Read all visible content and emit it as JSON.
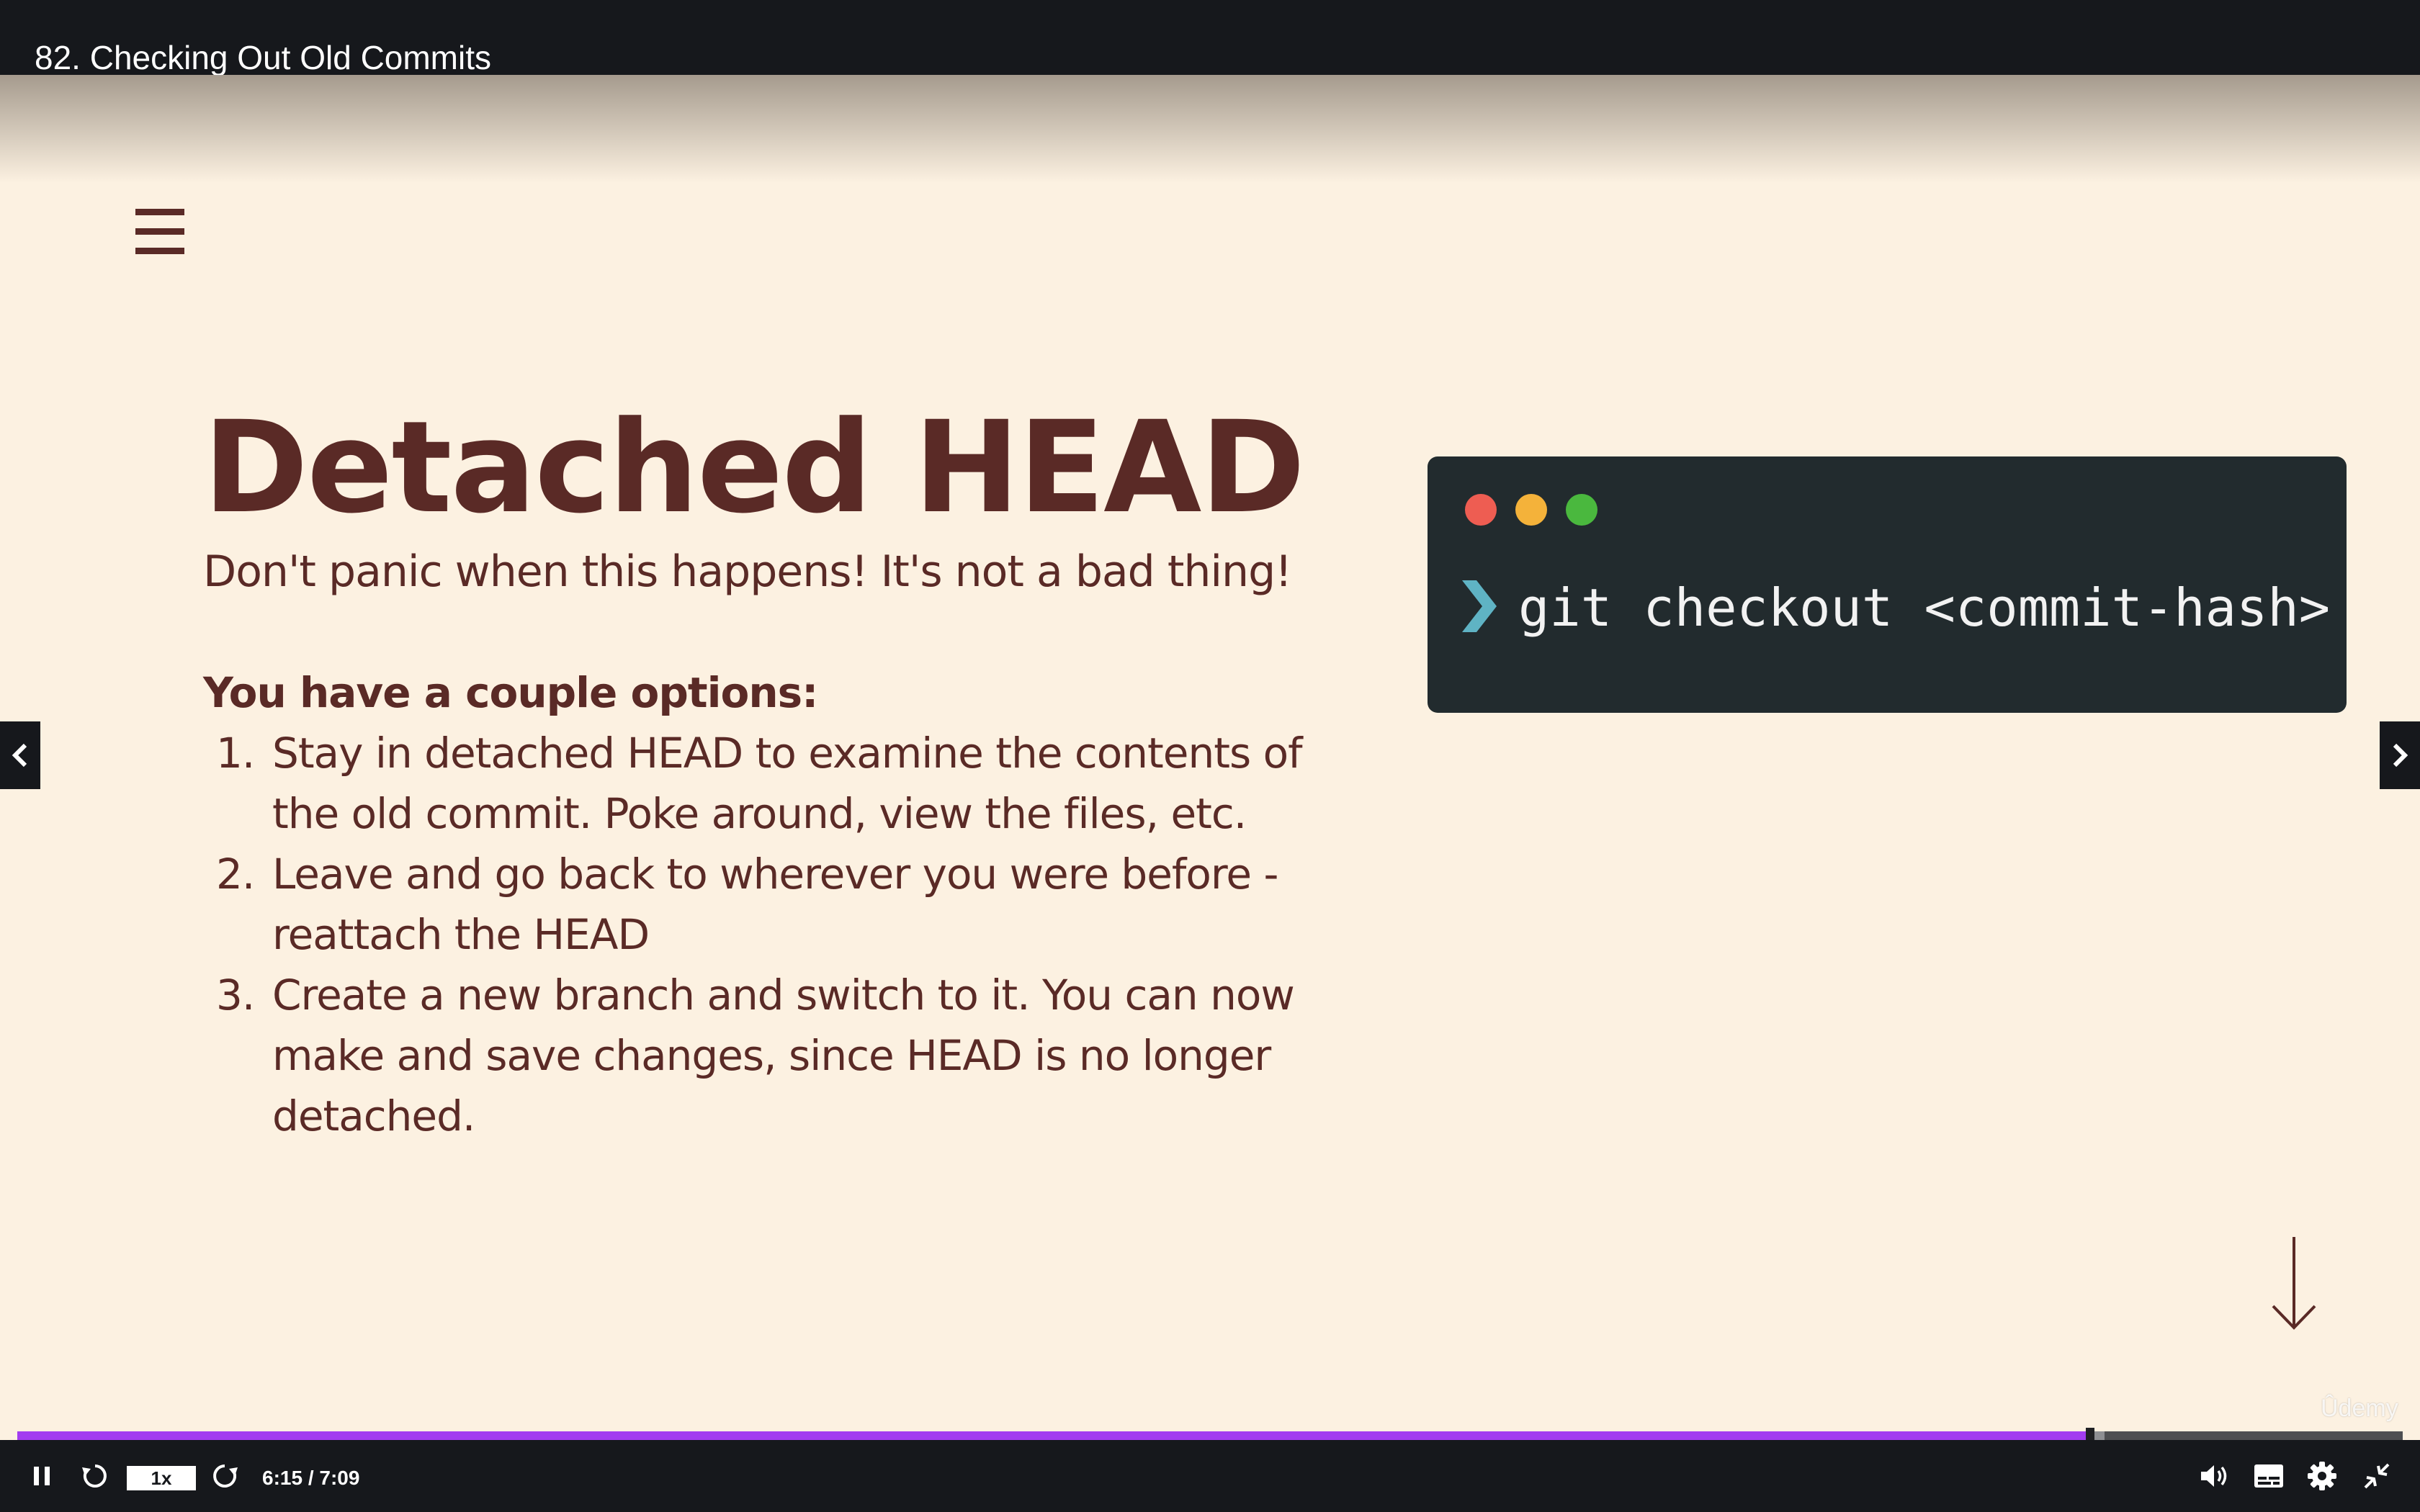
{
  "header": {
    "title": "82. Checking Out Old Commits"
  },
  "slide": {
    "heading": "Detached HEAD",
    "subtitle": "Don't panic when this happens! It's not a bad thing!",
    "options_heading": "You have a couple options:",
    "options": [
      {
        "number": "1.",
        "text": "Stay in detached HEAD to examine the contents of the old commit.  Poke around, view the files, etc."
      },
      {
        "number": "2.",
        "text": "Leave and go back to wherever you were before - reattach the HEAD"
      },
      {
        "number": "3.",
        "text": "Create a new branch and switch to it.  You can now make and save changes, since HEAD is no longer detached."
      }
    ],
    "terminal": {
      "command": "git checkout <commit-hash>"
    },
    "watermark": "Ûdemy"
  },
  "player": {
    "speed": "1x",
    "time": "6:15 / 7:09",
    "progress": 0.869,
    "buffered": 0.875,
    "accent_color": "#a23cf0"
  },
  "icons": {
    "menu": "hamburger-menu-icon",
    "prompt": "chevron-right-icon",
    "prev": "chevron-left-icon",
    "next": "chevron-right-icon",
    "scroll": "arrow-down-icon",
    "play_pause": "pause-icon",
    "rewind": "rewind-icon",
    "forward": "forward-icon",
    "volume": "volume-icon",
    "captions": "captions-icon",
    "settings": "gear-icon",
    "fullscreen": "exit-fullscreen-icon"
  }
}
